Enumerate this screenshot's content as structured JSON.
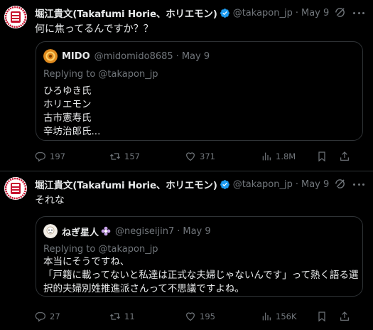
{
  "tweets": [
    {
      "author": {
        "display_name": "堀江貴文(Takafumi Horie、ホリエモン)",
        "handle": "@takapon_jp"
      },
      "dot": "·",
      "date": "May 9",
      "text": "何に焦ってるんですか？？",
      "quote": {
        "author_name": "MIDO",
        "handle": "@midomido8685",
        "dot": "·",
        "date": "May 9",
        "replying_to": "Replying to @takapon_jp",
        "lines": [
          "ひろゆき氏",
          "ホリエモン",
          "古市憲寿氏",
          "辛坊治郎氏..."
        ]
      },
      "stats": {
        "replies": "197",
        "retweets": "157",
        "likes": "371",
        "views": "1.8M"
      }
    },
    {
      "author": {
        "display_name": "堀江貴文(Takafumi Horie、ホリエモン)",
        "handle": "@takapon_jp"
      },
      "dot": "·",
      "date": "May 9",
      "text": "それな",
      "quote": {
        "author_name": "ねぎ星人",
        "handle": "@negiseijin7",
        "dot": "·",
        "date": "May 9",
        "replying_to": "Replying to @takapon_jp",
        "lines": [
          "本当にそうですね、",
          "「戸籍に載ってないと私達は正式な夫婦じゃないんです」って熱く語る選択的夫婦別姓推進派さんって不思議ですよね。"
        ]
      },
      "stats": {
        "replies": "27",
        "retweets": "11",
        "likes": "195",
        "views": "156K"
      }
    }
  ],
  "icons": {
    "verified": "verified-badge-icon",
    "grok": "grok-icon",
    "more": "more-icon",
    "reply": "reply-icon",
    "retweet": "retweet-icon",
    "like": "heart-icon",
    "views": "views-icon",
    "bookmark": "bookmark-icon",
    "share": "share-icon"
  },
  "colors": {
    "background": "#000000",
    "text": "#e7e9ea",
    "muted": "#71767b",
    "border": "#2f3336",
    "verified": "#1d9bf0",
    "avatar_red": "#c8102e"
  }
}
